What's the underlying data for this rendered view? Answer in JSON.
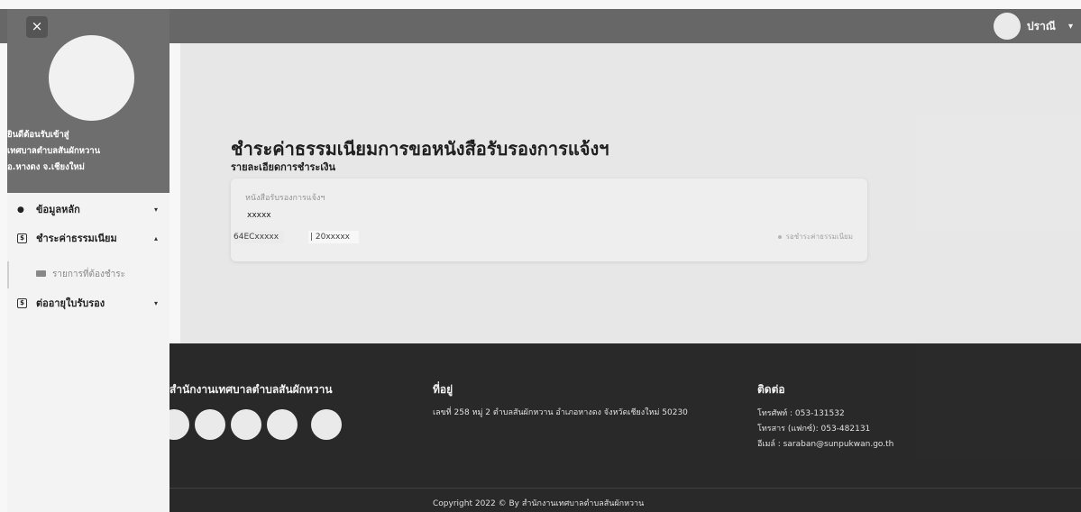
{
  "topbar": {
    "user_name": "ปราณี",
    "caret": "▾"
  },
  "sidebar": {
    "close_icon": "close-icon",
    "close_glyph": "×",
    "welcome_lines": [
      "ยินดีต้อนรับเข้าสู่",
      "เทศบาลตำบลสันผักหวาน",
      "อ.หางดง จ.เชียงใหม่"
    ],
    "items": [
      {
        "label": "ข้อมูลหลัก",
        "icon": "database-icon",
        "caret": "▾"
      },
      {
        "label": "ชำระค่าธรรมเนียม",
        "icon": "payment-icon",
        "caret": "▴"
      },
      {
        "label": "ต่ออายุใบรับรอง",
        "icon": "renew-icon",
        "caret": "▾"
      }
    ],
    "sub_item": {
      "label": "รายการที่ต้องชำระ",
      "icon": "bill-icon"
    }
  },
  "main": {
    "title": "ชำระค่าธรรมเนียมการขอหนังสือรับรองการแจ้งฯ",
    "subtitle": "รายละเอียดการชำระเงิน",
    "card": {
      "label": "หนังสือรับรองการแจ้งฯ",
      "value": "xxxxx",
      "code": "64ECxxxxx",
      "year": "| 20xxxxx",
      "status": "รอชำระค่าธรรมเนียม"
    }
  },
  "footer": {
    "org_title": "สำนักงานเทศบาลตำบลสันผักหวาน",
    "address_title": "ที่อยู่",
    "address": "เลขที่ 258 หมู่ 2 ตำบลสันผักหวาน อำเภอหางดง จังหวัดเชียงใหม่ 50230",
    "contact_title": "ติดต่อ",
    "phone": "โทรศัพท์ : 053-131532",
    "fax": "โทรสาร (แฟกซ์): 053-482131",
    "email": "อีเมล์ : saraban@sunpukwan.go.th",
    "copyright": "Copyright 2022 © By สำนักงานเทศบาลตำบลสันผักหวาน",
    "social_icons": [
      "social-icon-1",
      "social-icon-2",
      "social-icon-3",
      "social-icon-4",
      "social-icon-5"
    ]
  },
  "colors": {
    "topbar": "#6b6b6b",
    "sidebar_header": "#6e6e6e",
    "footer": "#2b2b2b",
    "content_bg": "#efefef"
  }
}
